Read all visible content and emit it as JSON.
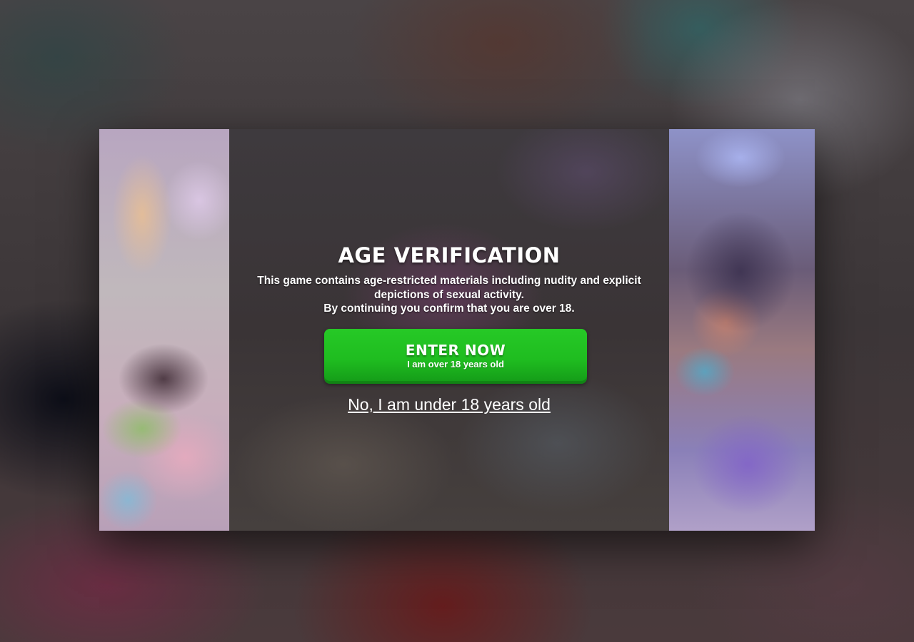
{
  "age_gate": {
    "title": "AGE VERIFICATION",
    "description_lines": [
      "This game contains age-restricted materials including nudity and explicit",
      "depictions of sexual activity.",
      "By continuing you confirm that you are over 18."
    ],
    "enter_button": {
      "label": "ENTER NOW",
      "sublabel": "I am over 18 years old"
    },
    "decline_link": "No, I am under 18 years old"
  },
  "colors": {
    "enter_button": "#1fbd20",
    "text": "#ffffff"
  }
}
